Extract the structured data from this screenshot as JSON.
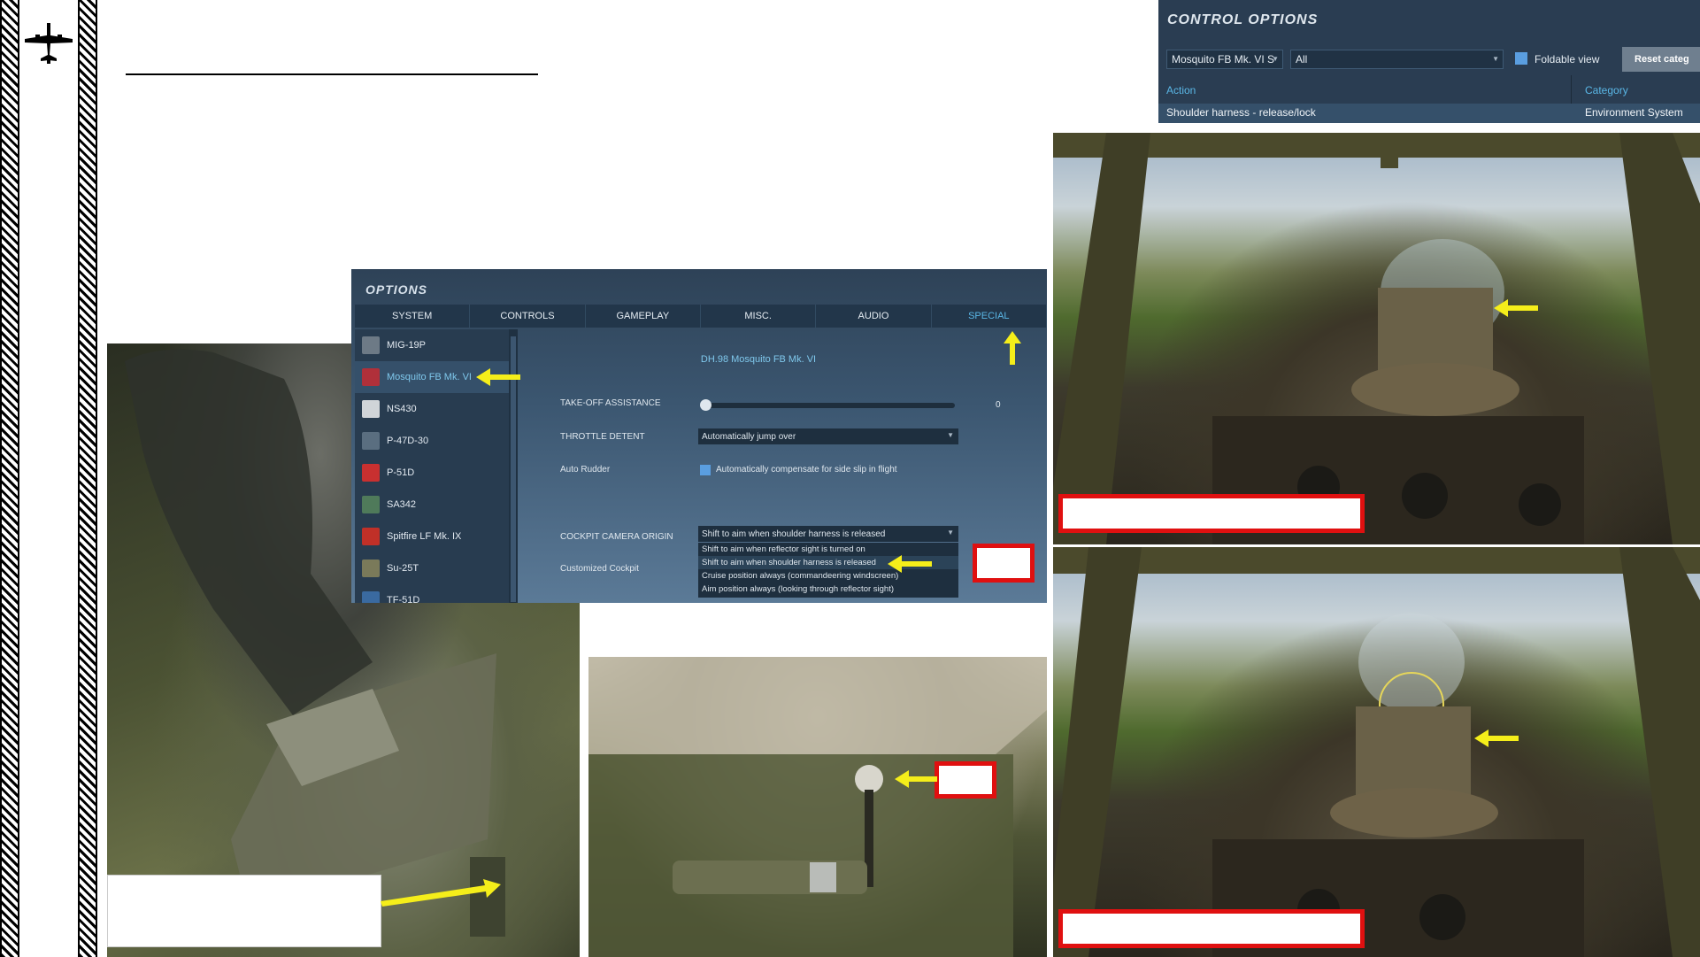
{
  "options_window": {
    "title": "OPTIONS",
    "tabs": [
      "SYSTEM",
      "CONTROLS",
      "GAMEPLAY",
      "MISC.",
      "AUDIO",
      "SPECIAL"
    ],
    "active_tab": "SPECIAL",
    "modules": [
      {
        "label": "MIG-19P",
        "icon_color": "#6d7a86"
      },
      {
        "label": "Mosquito FB Mk. VI",
        "icon_color": "#b0303a",
        "selected": true
      },
      {
        "label": "NS430",
        "icon_color": "#d0d4d8"
      },
      {
        "label": "P-47D-30",
        "icon_color": "#5a6e80"
      },
      {
        "label": "P-51D",
        "icon_color": "#c83030"
      },
      {
        "label": "SA342",
        "icon_color": "#4f7a5a"
      },
      {
        "label": "Spitfire LF Mk. IX",
        "icon_color": "#c03028"
      },
      {
        "label": "Su-25T",
        "icon_color": "#7a7a5a"
      },
      {
        "label": "TF-51D",
        "icon_color": "#3a6aa0"
      }
    ],
    "module_title": "DH.98 Mosquito FB Mk. VI",
    "settings": {
      "takeoff_label": "TAKE-OFF ASSISTANCE",
      "takeoff_value": "0",
      "takeoff_level": 0,
      "throttle_label": "THROTTLE DETENT",
      "throttle_value": "Automatically jump over",
      "auto_rudder_label": "Auto Rudder",
      "auto_rudder_text": "Automatically compensate for side slip in flight",
      "auto_rudder_checked": true,
      "camera_origin_label": "COCKPIT CAMERA ORIGIN",
      "camera_origin_value": "Shift to aim when shoulder harness is released",
      "customized_cockpit_label": "Customized Cockpit",
      "camera_options": [
        "Shift to aim when reflector sight is turned on",
        "Shift to aim when shoulder harness is released",
        "Cruise position always (commandeering windscreen)",
        "Aim position always (looking through reflector sight)"
      ]
    }
  },
  "control_window": {
    "title": "CONTROL OPTIONS",
    "aircraft_select": "Mosquito FB Mk. VI S",
    "category_select": "All",
    "foldable_label": "Foldable view",
    "reset_label": "Reset categ",
    "col_action": "Action",
    "col_category": "Category",
    "row_action": "Shoulder harness - release/lock",
    "row_category": "Environment System"
  },
  "colors": {
    "arrow_yellow": "#f5ee1a",
    "callout_red": "#e01010",
    "ui_accent": "#5ab7e6"
  },
  "icons": {
    "logo": "mosquito-plane-icon",
    "arrows": "yellow-arrow-icon"
  }
}
